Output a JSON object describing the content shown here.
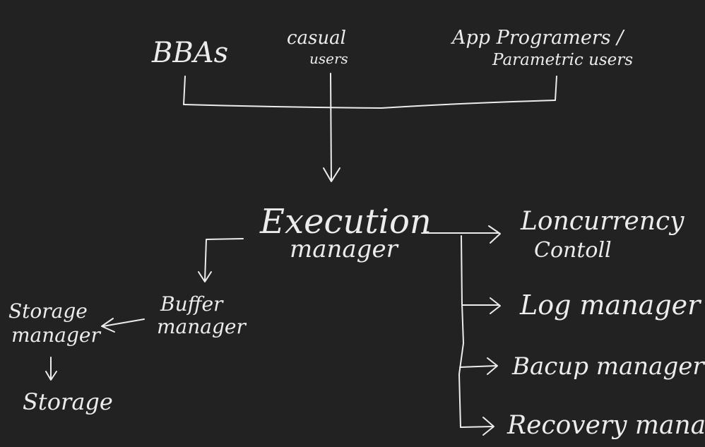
{
  "nodes": {
    "bbas": "BBAs",
    "casual_users_line1": "casual",
    "casual_users_line2": "users",
    "app_programmers_line1": "App Programers /",
    "app_programmers_line2": "Parametric users",
    "execution_manager_line1": "Execution",
    "execution_manager_line2": "manager",
    "concurrency_control_line1": "Loncurrency",
    "concurrency_control_line2": "Contoll",
    "log_manager": "Log manager",
    "backup_manager": "Bacup manager",
    "recovery_manager": "Recovery manager",
    "buffer_manager_line1": "Buffer",
    "buffer_manager_line2": "manager",
    "storage_manager_line1": "Storage",
    "storage_manager_line2": "manager",
    "storage": "Storage"
  },
  "colors": {
    "background": "#222222",
    "ink": "#ececec"
  }
}
